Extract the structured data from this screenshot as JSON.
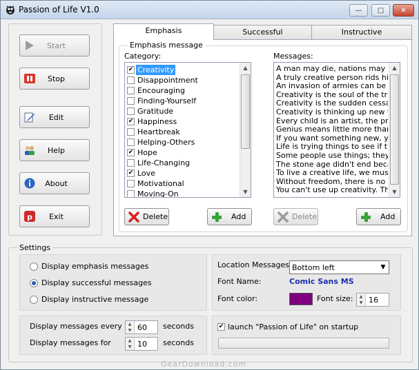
{
  "window": {
    "title": "Passion of Life V1.0"
  },
  "left_buttons": [
    {
      "label": "Start",
      "icon": "play-icon",
      "enabled": false
    },
    {
      "label": "Stop",
      "icon": "stop-icon",
      "enabled": true
    },
    {
      "label": "Edit",
      "icon": "edit-icon",
      "enabled": true
    },
    {
      "label": "Help",
      "icon": "help-icon",
      "enabled": true
    },
    {
      "label": "About",
      "icon": "info-icon",
      "enabled": true
    },
    {
      "label": "Exit",
      "icon": "exit-icon",
      "enabled": true
    }
  ],
  "tabs": [
    "Emphasis",
    "Successful",
    "Instructive"
  ],
  "active_tab": "Emphasis",
  "emphasis": {
    "group_label": "Emphasis message",
    "category_label": "Category:",
    "messages_label": "Messages:",
    "categories": [
      {
        "name": "Creativity",
        "checked": true,
        "selected": true
      },
      {
        "name": "Disappointment",
        "checked": false,
        "selected": false
      },
      {
        "name": "Encouraging",
        "checked": false,
        "selected": false
      },
      {
        "name": "Finding-Yourself",
        "checked": false,
        "selected": false
      },
      {
        "name": "Gratitude",
        "checked": false,
        "selected": false
      },
      {
        "name": "Happiness",
        "checked": true,
        "selected": false
      },
      {
        "name": "Heartbreak",
        "checked": false,
        "selected": false
      },
      {
        "name": "Helping-Others",
        "checked": false,
        "selected": false
      },
      {
        "name": "Hope",
        "checked": true,
        "selected": false
      },
      {
        "name": "Life-Changing",
        "checked": false,
        "selected": false
      },
      {
        "name": "Love",
        "checked": true,
        "selected": false
      },
      {
        "name": "Motivational",
        "checked": false,
        "selected": false
      },
      {
        "name": "Moving-On",
        "checked": false,
        "selected": false
      }
    ],
    "messages": [
      "A man may die, nations may rise ar",
      "A truly creative person rids him or h",
      "An invasion of armies can be resist",
      "Creativity is the soul of the true sch",
      "Creativity is the sudden cessation o",
      "Creativity is thinking up new things",
      "Every child is an artist, the problem",
      "Genius means little more than the f",
      "If you want something new, you hav",
      "Life is trying things to see if they wo",
      "Some people use things; they destr",
      "The stone age didn't end because",
      "To live a creative life, we must lose",
      "Without freedom, there is no creati",
      "You can't use up creativity. The m"
    ],
    "delete_label": "Delete",
    "add_label": "Add"
  },
  "settings": {
    "title": "Settings",
    "radios": [
      {
        "label": "Display emphasis messages",
        "selected": false
      },
      {
        "label": "Display successful messages",
        "selected": true
      },
      {
        "label": "Display instructive message",
        "selected": false
      }
    ],
    "location_label": "Location Messages:",
    "location_value": "Bottom left",
    "font_name_label": "Font Name:",
    "font_name_value": "Comic Sans MS",
    "font_color_label": "Font color:",
    "font_color": "#800080",
    "font_size_label": "Font size:",
    "font_size_value": "16",
    "every_label": "Display messages every",
    "every_value": "60",
    "for_label": "Display messages for",
    "for_value": "10",
    "seconds_label": "seconds",
    "startup_label": "launch \"Passion of Life\" on startup",
    "startup_checked": true
  },
  "watermark": "GearDownload.com",
  "colors": {
    "accent": "#3399ff",
    "font_name_blue": "#1a2fb0"
  }
}
